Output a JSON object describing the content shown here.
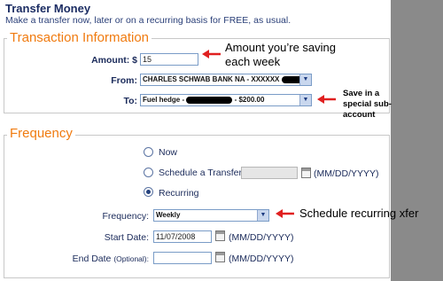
{
  "page": {
    "title": "Transfer Money",
    "subtitle": "Make a transfer now, later or on a recurring basis for FREE, as usual."
  },
  "transaction": {
    "legend": "Transaction Information",
    "amount_label": "Amount: $",
    "amount_value": "15",
    "from_label": "From:",
    "from_value": "CHARLES SCHWAB BANK NA - XXXXXX",
    "to_label": "To:",
    "to_value_prefix": "Fuel hedge -",
    "to_value_suffix": "- $200.00"
  },
  "frequency": {
    "legend": "Frequency",
    "options": [
      "Now",
      "Schedule a Transfer",
      "Recurring"
    ],
    "selected": "Recurring",
    "date_hint": "(MM/DD/YYYY)",
    "frequency_label": "Frequency:",
    "frequency_value": "Weekly",
    "start_label": "Start Date:",
    "start_value": "11/07/2008",
    "end_label": "End Date",
    "end_optional": "(Optional):",
    "end_value": ""
  },
  "annotations": {
    "amount_note": "Amount you’re saving each week",
    "to_note": "Save in a special sub-account",
    "frequency_note": "Schedule recurring xfer"
  },
  "colors": {
    "legend": "#f07b10",
    "arrow": "#e02020",
    "side_panel": "#8a8a8a"
  }
}
